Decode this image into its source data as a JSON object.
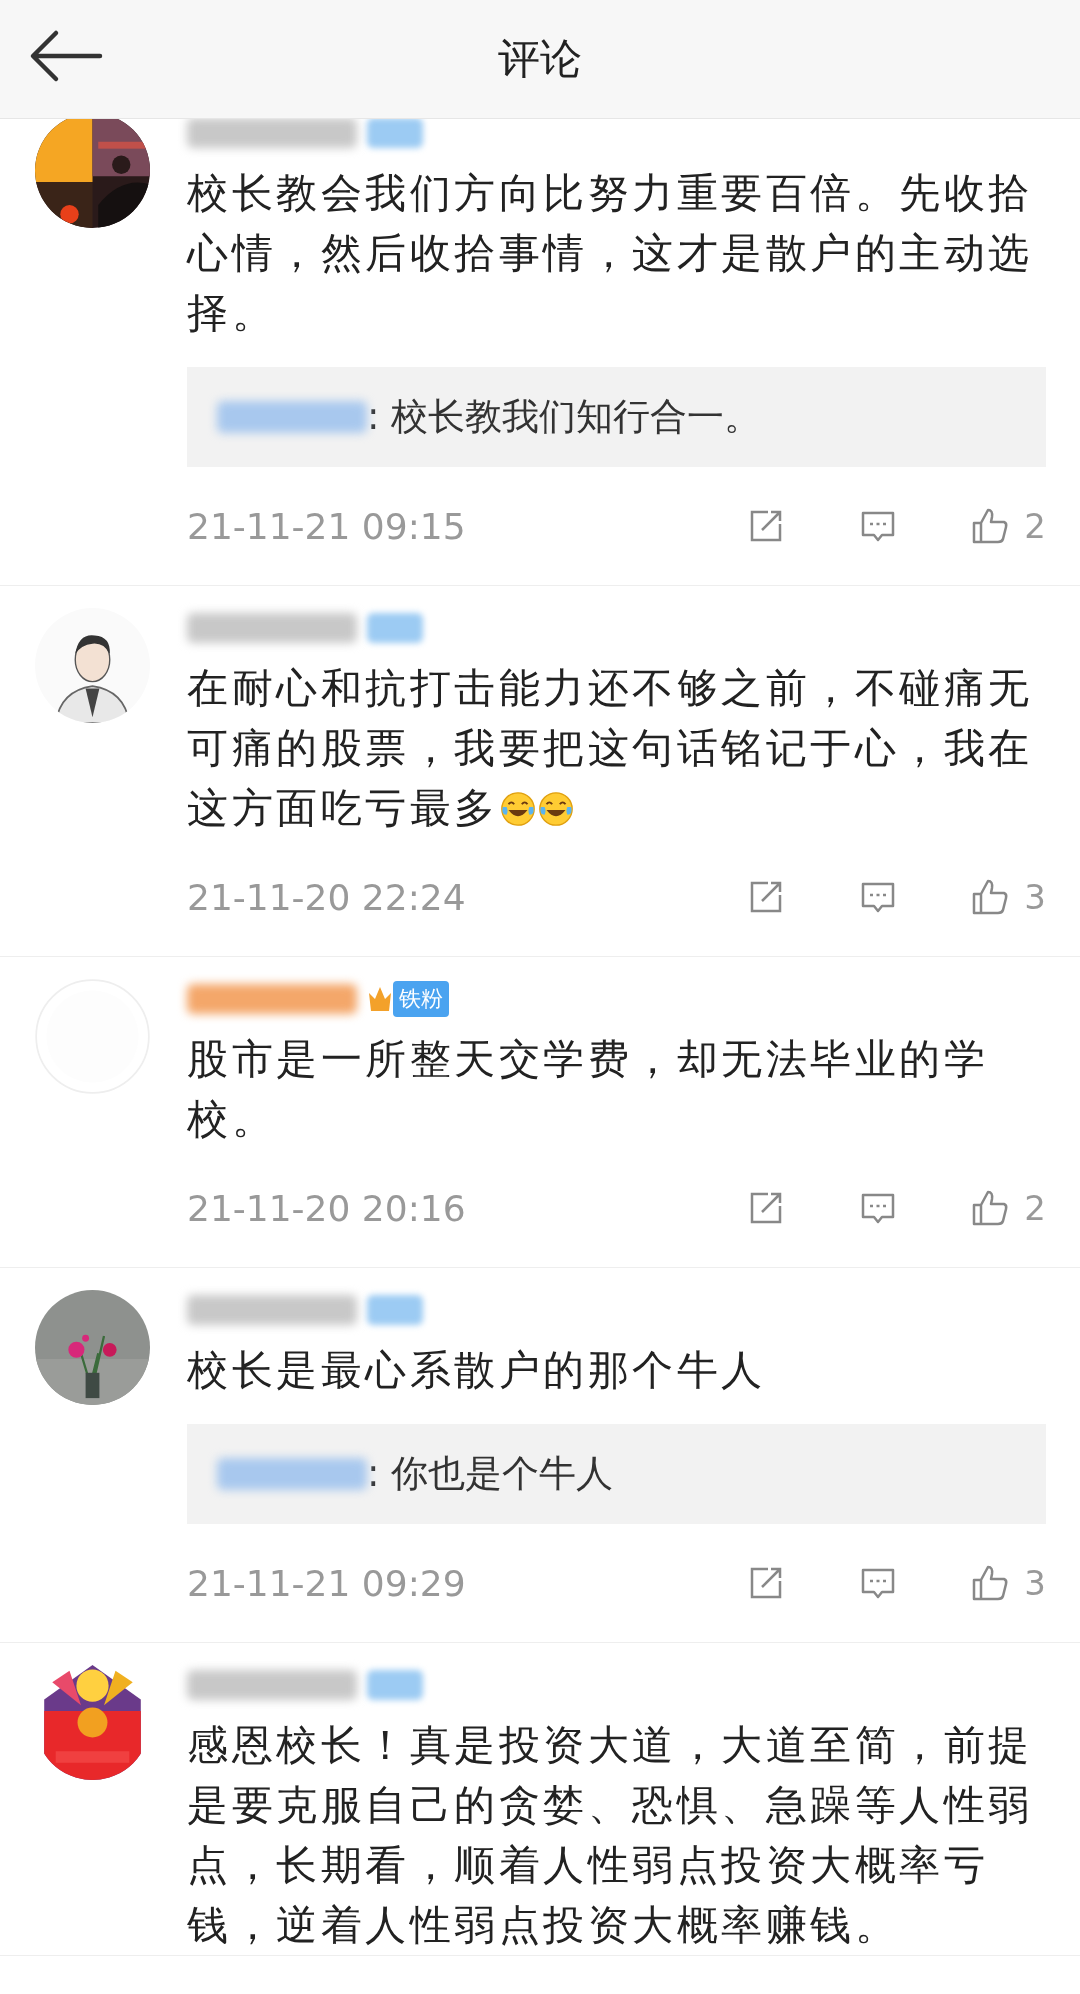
{
  "header": {
    "title": "评论"
  },
  "comments": [
    {
      "badge": {
        "kind": "blurred"
      },
      "text": "校长教会我们方向比努力重要百倍。先收拾心情，然后收拾事情，这才是散户的主动选择。",
      "reply": {
        "text": ": 校长教我们知行合一。"
      },
      "time": "21-11-21 09:15",
      "likes": "2"
    },
    {
      "badge": {
        "kind": "blurred"
      },
      "text": "在耐心和抗打击能力还不够之前，不碰痛无可痛的股票，我要把这句话铭记于心，我在这方面吃亏最多",
      "emojis": [
        {
          "kind": "laugh-cry"
        },
        {
          "kind": "laugh-cry"
        }
      ],
      "time": "21-11-20 22:24",
      "likes": "3"
    },
    {
      "badge": {
        "kind": "fan",
        "label": "铁粉"
      },
      "text": "股市是一所整天交学费，却无法毕业的学校。",
      "time": "21-11-20 20:16",
      "likes": "2"
    },
    {
      "badge": {
        "kind": "blurred"
      },
      "text": "校长是最心系散户的那个牛人",
      "reply": {
        "text": ": 你也是个牛人"
      },
      "time": "21-11-21 09:29",
      "likes": "3"
    },
    {
      "badge": {
        "kind": "blurred"
      },
      "text": "感恩校长！真是投资大道，大道至简，前提是要克服自己的贪婪、恐惧、急躁等人性弱点，长期看，顺着人性弱点投资大概率亏钱，逆着人性弱点投资大概率赚钱。"
    }
  ]
}
